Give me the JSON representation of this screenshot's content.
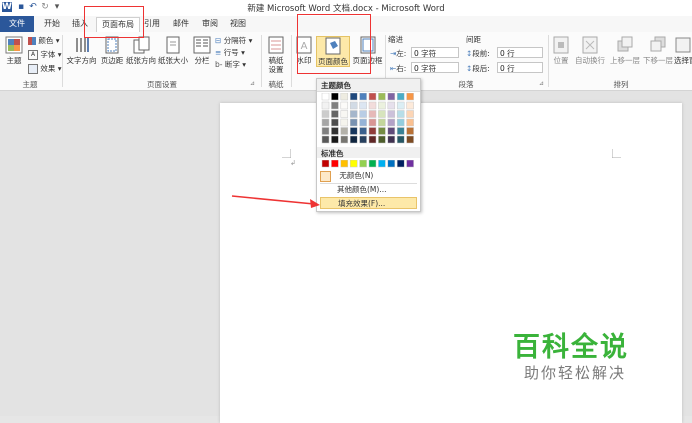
{
  "window": {
    "title": "新建 Microsoft Word 文档.docx - Microsoft Word"
  },
  "tabs": [
    {
      "label": "文件"
    },
    {
      "label": "开始"
    },
    {
      "label": "插入"
    },
    {
      "label": "页面布局"
    },
    {
      "label": "引用"
    },
    {
      "label": "邮件"
    },
    {
      "label": "审阅"
    },
    {
      "label": "视图"
    }
  ],
  "ribbon": {
    "theme": {
      "label": "主题",
      "colors": "颜色",
      "fonts": "字体",
      "effects": "效果",
      "group": "主题"
    },
    "page_setup": {
      "text_direction": "文字方向",
      "margins": "页边距",
      "orientation": "纸张方向",
      "size": "纸张大小",
      "columns": "分栏",
      "breaks": "分隔符",
      "line_numbers": "行号",
      "hyphenation": "断字",
      "group": "页面设置"
    },
    "draft": {
      "label1": "稿纸",
      "label2": "设置",
      "group": "稿纸"
    },
    "background": {
      "watermark": "水印",
      "page_color": "页面颜色",
      "page_border": "页面边框"
    },
    "paragraph": {
      "indent_title": "缩进",
      "spacing_title": "间距",
      "left_label": "左:",
      "left_value": "0 字符",
      "right_label": "右:",
      "right_value": "0 字符",
      "before_label": "段前:",
      "before_value": "0 行",
      "after_label": "段后:",
      "after_value": "0 行",
      "group": "段落"
    },
    "arrange": {
      "position": "位置",
      "wrap": "自动换行",
      "forward": "上移一层",
      "backward": "下移一层",
      "selection": "选择窗",
      "group": "排列"
    }
  },
  "dropdown": {
    "theme_colors_title": "主题颜色",
    "standard_colors_title": "标准色",
    "no_color": "无颜色(N)",
    "more_colors": "其他颜色(M)...",
    "fill_effects": "填充效果(F)...",
    "theme_top_row": [
      "#ffffff",
      "#000000",
      "#eeece1",
      "#1f497d",
      "#4f81bd",
      "#c0504d",
      "#9bbb59",
      "#8064a2",
      "#4bacc6",
      "#f79646"
    ],
    "standard_colors": [
      "#c00000",
      "#ff0000",
      "#ffc000",
      "#ffff00",
      "#92d050",
      "#00b050",
      "#00b0f0",
      "#0070c0",
      "#002060",
      "#7030a0"
    ]
  },
  "watermark": {
    "title": "百科全说",
    "subtitle": "助你轻松解决"
  }
}
